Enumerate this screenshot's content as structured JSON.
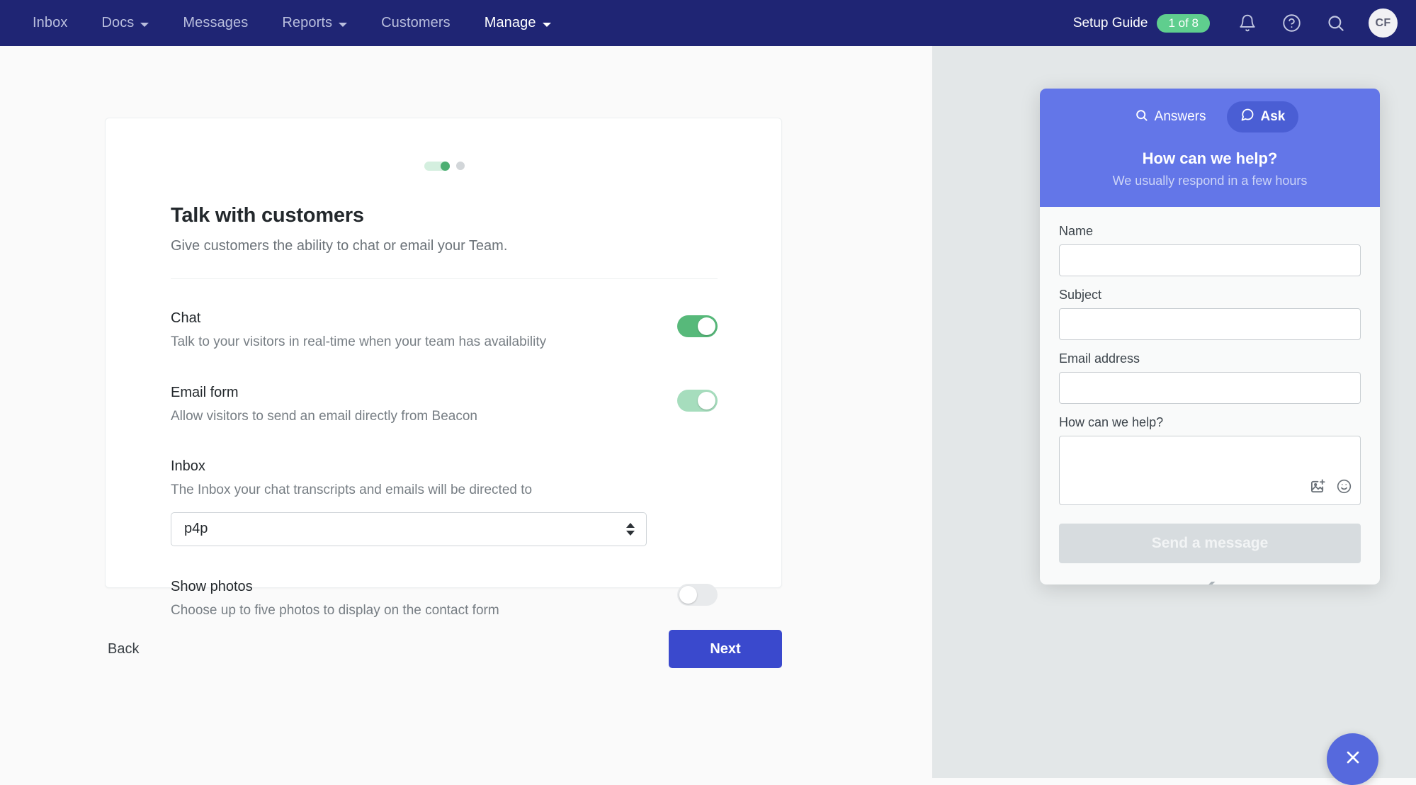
{
  "topnav": {
    "items": [
      {
        "label": "Inbox",
        "has_caret": false,
        "active": false
      },
      {
        "label": "Docs",
        "has_caret": true,
        "active": false
      },
      {
        "label": "Messages",
        "has_caret": false,
        "active": false
      },
      {
        "label": "Reports",
        "has_caret": true,
        "active": false
      },
      {
        "label": "Customers",
        "has_caret": false,
        "active": false
      },
      {
        "label": "Manage",
        "has_caret": true,
        "active": true
      }
    ],
    "setup_guide_label": "Setup Guide",
    "setup_guide_count": "1 of 8",
    "icons": [
      "bell-icon",
      "help-circle-icon",
      "search-icon"
    ],
    "avatar_initials": "CF",
    "bg_color": "#1f2574",
    "badge_color": "#5fce8e"
  },
  "card": {
    "progress": {
      "completed_steps": 1,
      "total_dots": 2
    },
    "title": "Talk with customers",
    "subtitle": "Give customers the ability to chat or email your Team.",
    "settings": [
      {
        "label": "Chat",
        "description": "Talk to your visitors in real-time when your team has availability",
        "toggle_state": "on"
      },
      {
        "label": "Email form",
        "description": "Allow visitors to send an email directly from Beacon",
        "toggle_state": "on-muted"
      }
    ],
    "inbox": {
      "label": "Inbox",
      "description": "The Inbox your chat transcripts and emails will be directed to",
      "selected_value": "p4p"
    },
    "show_photos": {
      "label": "Show photos",
      "description": "Choose up to five photos to display on the contact form",
      "toggle_state": "off"
    }
  },
  "footer": {
    "back_label": "Back",
    "next_label": "Next",
    "next_color": "#3a49cd"
  },
  "beacon": {
    "tabs": [
      {
        "label": "Answers",
        "icon": "search-icon",
        "active": false
      },
      {
        "label": "Ask",
        "icon": "chat-bubble-icon",
        "active": true
      }
    ],
    "heading": "How can we help?",
    "subheading": "We usually respond in a few hours",
    "header_color": "#6376e8",
    "fields": [
      {
        "label": "Name",
        "value": "",
        "type": "text"
      },
      {
        "label": "Subject",
        "value": "",
        "type": "text"
      },
      {
        "label": "Email address",
        "value": "",
        "type": "text"
      }
    ],
    "message_field": {
      "label": "How can we help?",
      "value": ""
    },
    "attach_icons": [
      "add-image-icon",
      "emoji-icon"
    ],
    "send_label": "Send a message",
    "send_disabled": true,
    "brand_logo": "help-scout-logo",
    "close_icon": "close-icon"
  }
}
